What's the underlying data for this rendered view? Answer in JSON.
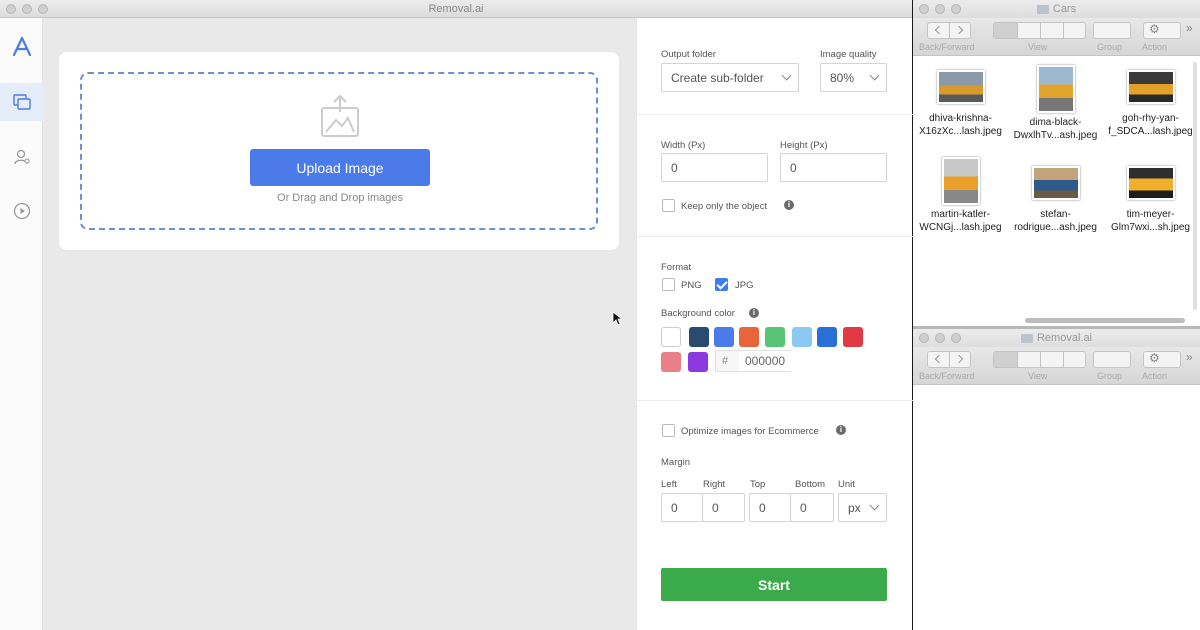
{
  "app": {
    "title": "Removal.ai",
    "sidebar": [
      "logo-icon",
      "images-icon",
      "user-icon",
      "play-icon"
    ],
    "upload": {
      "button": "Upload Image",
      "hint": "Or Drag and Drop images"
    }
  },
  "settings": {
    "output_folder_label": "Output folder",
    "output_folder_value": "Create sub-folder",
    "quality_label": "Image quality",
    "quality_value": "80%",
    "width_label": "Width (Px)",
    "width_value": "0",
    "height_label": "Height (Px)",
    "height_value": "0",
    "keep_object": "Keep only the object",
    "format_label": "Format",
    "png_label": "PNG",
    "jpg_label": "JPG",
    "jpg_checked": true,
    "bg_label": "Background color",
    "swatches": [
      "#ffffff",
      "#2b4a6f",
      "#4a7be8",
      "#e8643a",
      "#57c476",
      "#8cc9f2",
      "#2a6fd6",
      "#e23a45",
      "#ea7f8a",
      "#8c3ae0"
    ],
    "hex_prefix": "#",
    "hex_value": "000000",
    "optimize": "Optimize images for Ecommerce",
    "margin_label": "Margin",
    "margin_cols": [
      "Left",
      "Right",
      "Top",
      "Bottom",
      "Unit"
    ],
    "margin_values": [
      "0",
      "0",
      "0",
      "0"
    ],
    "unit_value": "px",
    "start": "Start"
  },
  "finder_cars": {
    "title": "Cars",
    "toolbar": [
      "Back/Forward",
      "View",
      "Group",
      "Action"
    ],
    "files": [
      {
        "line1": "dhiva-krishna-",
        "line2": "X16zXc...lash.jpeg"
      },
      {
        "line1": "dima-black-",
        "line2": "DwxlhTv...ash.jpeg"
      },
      {
        "line1": "goh-rhy-yan-",
        "line2": "f_SDCA...lash.jpeg"
      },
      {
        "line1": "martin-katler-",
        "line2": "WCNGj...lash.jpeg"
      },
      {
        "line1": "stefan-",
        "line2": "rodrigue...ash.jpeg"
      },
      {
        "line1": "tim-meyer-",
        "line2": "Glm7wxi...sh.jpeg"
      }
    ]
  },
  "finder_removal": {
    "title": "Removal.ai",
    "toolbar": [
      "Back/Forward",
      "View",
      "Group",
      "Action"
    ]
  },
  "toolbar_chevrons": "»"
}
